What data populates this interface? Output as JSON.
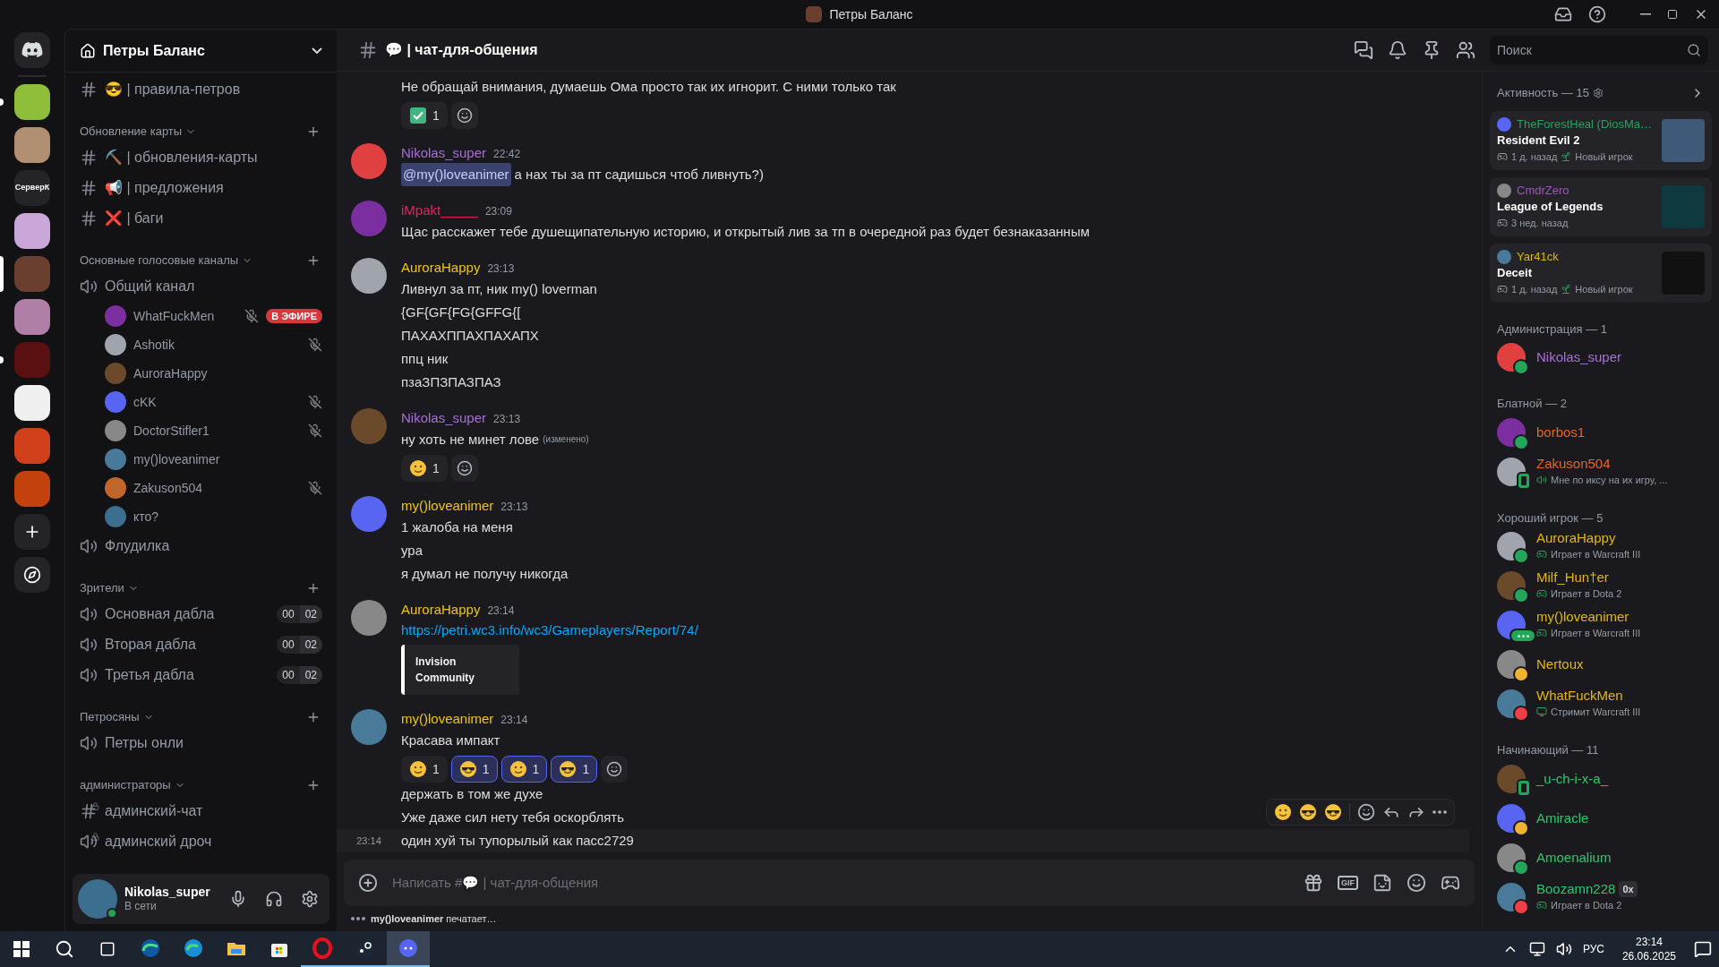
{
  "window": {
    "title": "Петры Баланс"
  },
  "servers": [
    {
      "kind": "picture",
      "selected": false,
      "unread": true
    },
    {
      "kind": "picture",
      "selected": false,
      "unread": false
    },
    {
      "kind": "text",
      "label": "СерверК",
      "selected": false,
      "unread": false
    },
    {
      "kind": "picture",
      "selected": false,
      "unread": false
    },
    {
      "kind": "picture",
      "selected": true,
      "unread": false
    },
    {
      "kind": "picture",
      "selected": false,
      "unread": false
    },
    {
      "kind": "picture",
      "selected": false,
      "unread": true
    },
    {
      "kind": "picture",
      "selected": false,
      "unread": false
    },
    {
      "kind": "picture",
      "selected": false,
      "unread": false
    },
    {
      "kind": "picture",
      "selected": false,
      "unread": false
    }
  ],
  "server": {
    "name": "Петры Баланс"
  },
  "channels": [
    {
      "kind": "text",
      "name": "😎 | правила-петров"
    }
  ],
  "categories": [
    {
      "title": "Обновление карты",
      "channels": [
        {
          "kind": "text",
          "name": "⛏️ | обновления-карты"
        },
        {
          "kind": "text",
          "name": "📢 | предложения"
        },
        {
          "kind": "text",
          "name": "❌ | баги"
        }
      ]
    },
    {
      "title": "Основные голосовые каналы",
      "channels": [
        {
          "kind": "voice",
          "name": "Общий канал",
          "members": [
            {
              "name": "WhatFuckMen",
              "muted": true,
              "live": "В ЭФИРЕ"
            },
            {
              "name": "Ashotik",
              "muted": true
            },
            {
              "name": "AuroraHappy",
              "muted": false
            },
            {
              "name": "cKK",
              "muted": true
            },
            {
              "name": "DoctorStifler1",
              "muted": true
            },
            {
              "name": "my()loveanimer",
              "muted": false
            },
            {
              "name": "Zakuson504",
              "muted": true
            },
            {
              "name": "кто?",
              "muted": false
            }
          ]
        },
        {
          "kind": "voice",
          "name": "Флудилка"
        }
      ]
    },
    {
      "title": "Зрители",
      "channels": [
        {
          "kind": "voice",
          "name": "Основная дабла",
          "counts": [
            "00",
            "02"
          ]
        },
        {
          "kind": "voice",
          "name": "Вторая дабла",
          "counts": [
            "00",
            "02"
          ]
        },
        {
          "kind": "voice",
          "name": "Третья дабла",
          "counts": [
            "00",
            "02"
          ]
        }
      ]
    },
    {
      "title": "Петросяны",
      "channels": [
        {
          "kind": "voice",
          "name": "Петры онли"
        }
      ]
    },
    {
      "title": "администраторы",
      "channels": [
        {
          "kind": "text-locked",
          "name": "админский-чат"
        },
        {
          "kind": "voice-locked",
          "name": "админский дроч"
        }
      ]
    }
  ],
  "user": {
    "name": "Nikolas_super",
    "status": "В сети"
  },
  "chat": {
    "channel": "💬 | чат-для-общения",
    "search": {
      "placeholder": "Поиск"
    },
    "messages": [
      {
        "lines": [
          "Не обращай внимания, думаешь Ома просто так их игнорит. С ними только так"
        ],
        "reactions": [
          {
            "kind": "check",
            "count": "1",
            "selected": false
          }
        ]
      },
      {
        "author": "Nikolas_super",
        "color": "#a86fd8",
        "time": "22:42",
        "mention": "@my()loveanimer",
        "lines": [
          "а нах ты за пт садишься чтоб ливнуть?)"
        ]
      },
      {
        "author": "iMpakt_____",
        "color": "#e3245c",
        "time": "23:09",
        "lines": [
          "Щас расскажет тебе душещипательную историю, и открытый лив за тп в очередной раз будет безнаказанным"
        ]
      },
      {
        "author": "AuroraHappy",
        "color": "#f1c40f",
        "time": "23:13",
        "lines": [
          "Ливнул за пт, ник my() loverman",
          "{GF{GF{FG{GFFG{[",
          "ПАХАХППАХПАХАПХ",
          "ппц ник",
          "пзаЗПЗПАЗПАЗ"
        ]
      },
      {
        "author": "Nikolas_super",
        "color": "#a86fd8",
        "time": "23:13",
        "lines": [
          "ну хоть не минет лове"
        ],
        "edited": "(изменено)",
        "reactions": [
          {
            "kind": "face",
            "count": "1",
            "selected": false
          }
        ]
      },
      {
        "author": "my()loveanimer",
        "color": "#f1c40f",
        "time": "23:13",
        "lines": [
          "1 жалоба на меня",
          "ура",
          "я думал не получу никогда"
        ]
      },
      {
        "author": "AuroraHappy",
        "color": "#f1c40f",
        "time": "23:14",
        "link": "https://petri.wc3.info/wc3/Gameplayers/Report/74/",
        "embed": "Invision Community"
      },
      {
        "author": "my()loveanimer",
        "color": "#f1c40f",
        "time": "23:14",
        "lines": [
          "Красава импакт"
        ],
        "reactions": [
          {
            "kind": "face",
            "count": "1",
            "selected": false
          },
          {
            "kind": "face",
            "count": "1",
            "selected": true
          },
          {
            "kind": "face",
            "count": "1",
            "selected": true
          },
          {
            "kind": "face",
            "count": "1",
            "selected": true
          }
        ],
        "more_lines": [
          "держать в том же духе",
          "Уже даже сил нету тебя оскорблять"
        ],
        "hovered_line": {
          "time": "23:14",
          "text": "один хуй ты тупорылый как пасс2729"
        }
      }
    ],
    "input": {
      "placeholder": "Написать #💬 | чат-для-общения",
      "gif_label": "GIF"
    },
    "typing": "**my()loveanimer** печатает…"
  },
  "activity": {
    "title": "Активность — 15",
    "cards": [
      {
        "user": "TheForestHeal (DiosMa…",
        "color": "#23a55a",
        "game": "Resident Evil 2",
        "time": "1 д. назад",
        "badge": "Новый игрок"
      },
      {
        "user": "CmdrZero",
        "color": "#9b59b6",
        "game": "League of Legends",
        "time": "3 нед. назад"
      },
      {
        "user": "Yar41ck",
        "color": "#e0b416",
        "game": "Deceit",
        "time": "1 д. назад",
        "badge": "Новый игрок"
      }
    ]
  },
  "groups": [
    {
      "title": "Администрация — 1",
      "members": [
        {
          "name": "Nikolas_super",
          "color": "#a86fd8",
          "kind": "online"
        }
      ]
    },
    {
      "title": "Блатной — 2",
      "members": [
        {
          "name": "borbos1",
          "color": "#e8661e",
          "kind": "online"
        },
        {
          "name": "Zakuson504",
          "color": "#e8661e",
          "kind": "mobile",
          "activity": {
            "kind": "voice",
            "text": "Мне по иксу на их игру, ..."
          }
        }
      ]
    },
    {
      "title": "Хороший игрок — 5",
      "members": [
        {
          "name": "AuroraHappy",
          "color": "#e6b412",
          "kind": "online",
          "activity": {
            "kind": "game",
            "text": "Играет в Warcraft III"
          }
        },
        {
          "name": "Milf_Hun†er",
          "color": "#e6b412",
          "kind": "online",
          "activity": {
            "kind": "game",
            "text": "Играет в Dota 2"
          }
        },
        {
          "name": "my()loveanimer",
          "color": "#e6b412",
          "kind": "typing",
          "activity": {
            "kind": "game",
            "text": "Играет в Warcraft III"
          }
        },
        {
          "name": "Nertoux",
          "color": "#e6b412",
          "kind": "idle"
        },
        {
          "name": "WhatFuckMen",
          "color": "#e6b412",
          "kind": "dnd",
          "activity": {
            "kind": "stream",
            "text": "Стримит Warcraft III"
          }
        }
      ]
    },
    {
      "title": "Начинающий — 11",
      "members": [
        {
          "name": "_u-ch-i-x-a_",
          "color": "#2dc770",
          "kind": "mobile"
        },
        {
          "name": "Amiracle",
          "color": "#2dc770",
          "kind": "idle"
        },
        {
          "name": "Amoenalium",
          "color": "#2dc770",
          "kind": "online"
        },
        {
          "name": "Boozamn228",
          "color": "#2dc770",
          "kind": "dnd",
          "tag": "0x",
          "activity": {
            "kind": "game",
            "text": "Играет в Dota 2"
          }
        }
      ]
    }
  ],
  "taskbar": {
    "apps": [
      {
        "running": false,
        "selected": false
      },
      {
        "running": false,
        "selected": false
      },
      {
        "running": false,
        "selected": false
      },
      {
        "running": false,
        "selected": false
      },
      {
        "running": true,
        "selected": false
      },
      {
        "running": true,
        "selected": false
      },
      {
        "running": true,
        "selected": true
      }
    ],
    "lang": "РУС",
    "time": "23:14",
    "date": "26.06.2025"
  }
}
